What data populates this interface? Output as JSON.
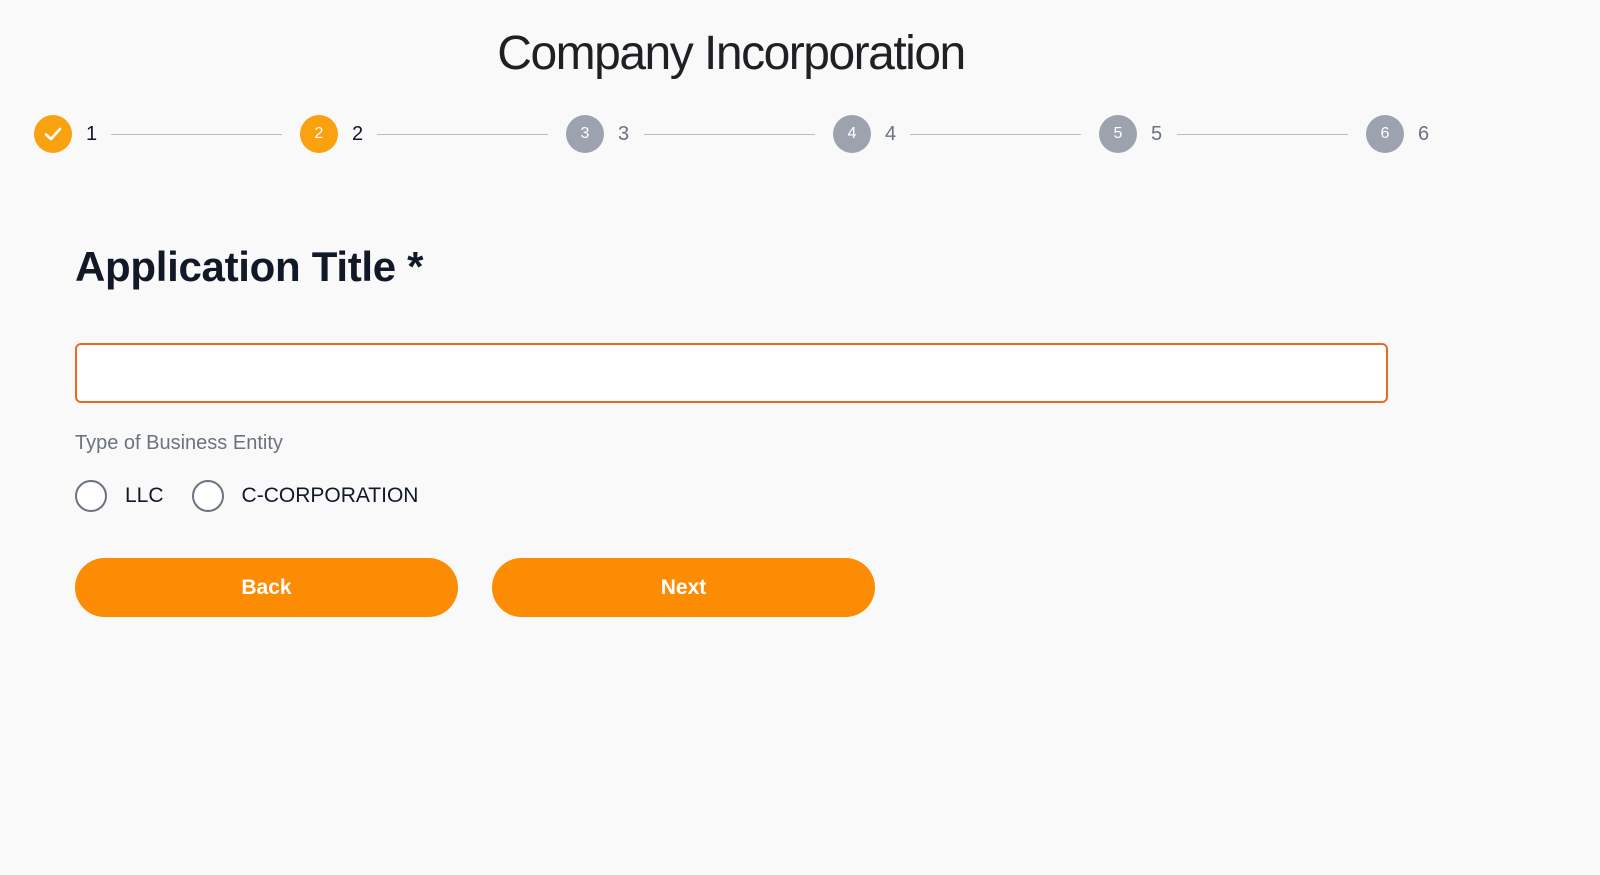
{
  "header": {
    "title": "Company Incorporation"
  },
  "stepper": {
    "current_step": 2,
    "steps": [
      {
        "number": "1",
        "label": "1",
        "status": "done"
      },
      {
        "number": "2",
        "label": "2",
        "status": "active"
      },
      {
        "number": "3",
        "label": "3",
        "status": "pending"
      },
      {
        "number": "4",
        "label": "4",
        "status": "pending"
      },
      {
        "number": "5",
        "label": "5",
        "status": "pending"
      },
      {
        "number": "6",
        "label": "6",
        "status": "pending"
      }
    ]
  },
  "form": {
    "heading": "Application Title *",
    "title_input": {
      "value": "",
      "placeholder": ""
    },
    "entity_label": "Type of Business Entity",
    "entity_options": [
      {
        "label": "LLC",
        "selected": false
      },
      {
        "label": "C-CORPORATION",
        "selected": false
      }
    ]
  },
  "actions": {
    "back_label": "Back",
    "next_label": "Next"
  },
  "colors": {
    "accent": "#fc8c04",
    "step_active": "#f9a10f",
    "step_pending": "#9ca3af",
    "input_border": "#ea6a1f"
  },
  "icons": {
    "completed_step": "check-icon"
  }
}
